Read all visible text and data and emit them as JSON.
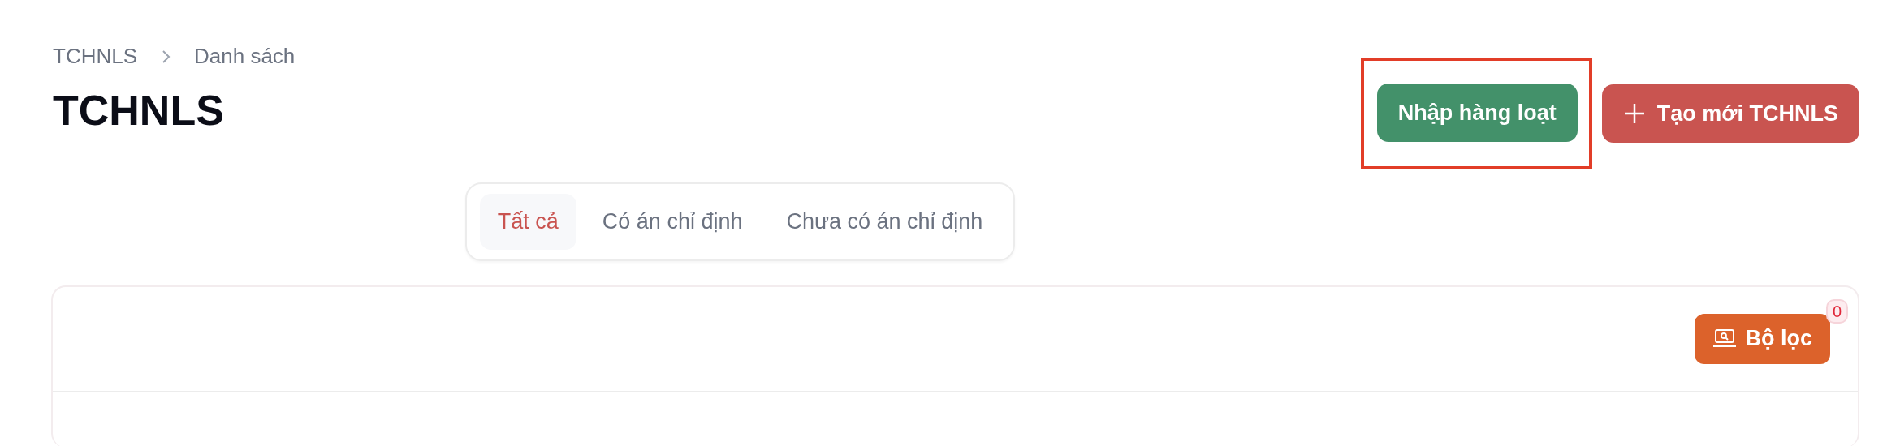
{
  "breadcrumb": [
    {
      "label": "TCHNLS"
    },
    {
      "label": "Danh sách"
    }
  ],
  "title": "TCHNLS",
  "actions": [
    {
      "label": "Nhập hàng loạt",
      "kind": "import",
      "highlighted": true
    },
    {
      "label": "Tạo mới TCHNLS",
      "kind": "create",
      "highlighted": false
    }
  ],
  "tabs": [
    {
      "label": "Tất cả",
      "selected": true
    },
    {
      "label": "Có án chỉ định",
      "selected": false
    },
    {
      "label": "Chưa có án chỉ định",
      "selected": false
    }
  ],
  "filter": {
    "label": "Bộ lọc",
    "count": "0"
  }
}
